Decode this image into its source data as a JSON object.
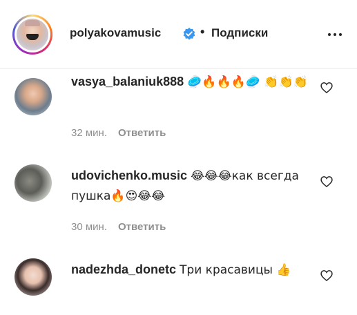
{
  "post": {
    "username": "polyakovamusic",
    "verified_icon": "verified-badge-icon",
    "separator": "•",
    "follow_label": "Подписки",
    "more_icon": "more-options-icon"
  },
  "comments": [
    {
      "username": "vasya_balaniuk888",
      "text": "🥏🔥🔥🔥🥏 👏👏👏",
      "time": "32 мин.",
      "reply_label": "Ответить"
    },
    {
      "username": "udovichenko.music",
      "text": "😂😂😂как всегда пушка🔥😍😂😂",
      "time": "30 мин.",
      "reply_label": "Ответить"
    },
    {
      "username": "nadezhda_donetc",
      "text": "Три красавицы 👍",
      "time": "",
      "reply_label": ""
    }
  ],
  "colors": {
    "accent_verified": "#3897f0",
    "text": "#262626",
    "meta": "#8e8e8e"
  }
}
